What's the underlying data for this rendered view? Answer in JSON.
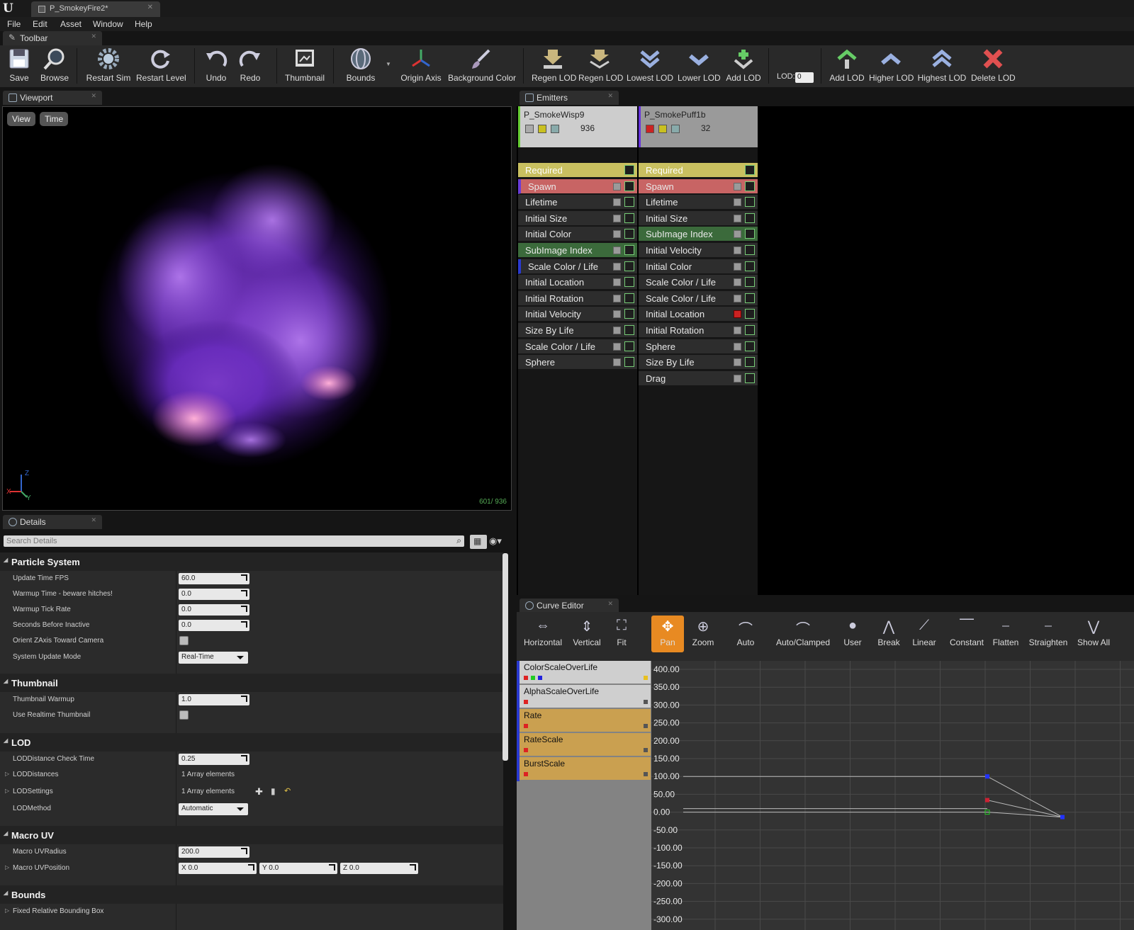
{
  "document": {
    "tab_title": "P_SmokeyFire2*"
  },
  "menu": [
    "File",
    "Edit",
    "Asset",
    "Window",
    "Help"
  ],
  "panels": {
    "toolbar": "Toolbar",
    "viewport": "Viewport",
    "details": "Details",
    "emitters": "Emitters",
    "curve_editor": "Curve Editor"
  },
  "toolbar": {
    "buttons": [
      "Save",
      "Browse",
      "Restart Sim",
      "Restart Level",
      "Undo",
      "Redo",
      "Thumbnail",
      "Bounds",
      "Origin Axis",
      "Background Color",
      "Regen LOD",
      "Regen LOD",
      "Lowest LOD",
      "Lower LOD",
      "Add LOD",
      "Add LOD",
      "Higher LOD",
      "Highest LOD",
      "Delete LOD"
    ],
    "lod_label": "LOD:",
    "lod_value": "0"
  },
  "viewport": {
    "view_button": "View",
    "time_button": "Time",
    "particle_count": "601/ 936",
    "axis_labels": [
      "Z",
      "X",
      "Y"
    ]
  },
  "details": {
    "search_placeholder": "Search Details",
    "categories": {
      "particle_system": {
        "title": "Particle System",
        "update_time_fps": {
          "label": "Update Time FPS",
          "value": "60.0"
        },
        "warmup_time": {
          "label": "Warmup Time - beware hitches!",
          "value": "0.0"
        },
        "warmup_tick_rate": {
          "label": "Warmup Tick Rate",
          "value": "0.0"
        },
        "seconds_before_inactive": {
          "label": "Seconds Before Inactive",
          "value": "0.0"
        },
        "orient_zaxis": {
          "label": "Orient ZAxis Toward Camera"
        },
        "system_update_mode": {
          "label": "System Update Mode",
          "value": "Real-Time"
        }
      },
      "thumbnail": {
        "title": "Thumbnail",
        "thumbnail_warmup": {
          "label": "Thumbnail Warmup",
          "value": "1.0"
        },
        "use_realtime_thumbnail": {
          "label": "Use Realtime Thumbnail"
        }
      },
      "lod": {
        "title": "LOD",
        "lod_distance_check_time": {
          "label": "LODDistance Check Time",
          "value": "0.25"
        },
        "lod_distances": {
          "label": "LODDistances",
          "value": "1 Array elements"
        },
        "lod_settings": {
          "label": "LODSettings",
          "value": "1 Array elements"
        },
        "lod_method": {
          "label": "LODMethod",
          "value": "Automatic"
        }
      },
      "macro_uv": {
        "title": "Macro UV",
        "macro_uv_radius": {
          "label": "Macro UVRadius",
          "value": "200.0"
        },
        "macro_uv_position": {
          "label": "Macro UVPosition",
          "x": "X  0.0",
          "y": "Y  0.0",
          "z": "Z  0.0"
        }
      },
      "bounds": {
        "title": "Bounds",
        "fixed_relative_bbox": {
          "label": "Fixed Relative Bounding Box"
        }
      }
    }
  },
  "emitters": [
    {
      "name": "P_SmokeWisp9",
      "count": "936",
      "modules": [
        {
          "label": "Required",
          "kind": "required"
        },
        {
          "label": "Spawn",
          "kind": "spawn"
        },
        {
          "label": "Lifetime"
        },
        {
          "label": "Initial Size"
        },
        {
          "label": "Initial Color"
        },
        {
          "label": "SubImage Index",
          "kind": "green"
        },
        {
          "label": "Scale Color / Life",
          "kind": "blue"
        },
        {
          "label": "Initial Location"
        },
        {
          "label": "Initial Rotation"
        },
        {
          "label": "Initial Velocity"
        },
        {
          "label": "Size By Life"
        },
        {
          "label": "Scale Color / Life"
        },
        {
          "label": "Sphere"
        }
      ]
    },
    {
      "name": "P_SmokePuff1b",
      "count": "32",
      "modules": [
        {
          "label": "Required",
          "kind": "required"
        },
        {
          "label": "Spawn",
          "kind": "spawn"
        },
        {
          "label": "Lifetime"
        },
        {
          "label": "Initial Size"
        },
        {
          "label": "SubImage Index",
          "kind": "green"
        },
        {
          "label": "Initial Velocity"
        },
        {
          "label": "Initial Color"
        },
        {
          "label": "Scale Color / Life"
        },
        {
          "label": "Scale Color / Life"
        },
        {
          "label": "Initial Location",
          "disabled": true
        },
        {
          "label": "Initial Rotation"
        },
        {
          "label": "Sphere"
        },
        {
          "label": "Size By Life"
        },
        {
          "label": "Drag"
        }
      ]
    }
  ],
  "curve_editor": {
    "buttons": [
      "Horizontal",
      "Vertical",
      "Fit",
      "Pan",
      "Zoom",
      "Auto",
      "Auto/Clamped",
      "User",
      "Break",
      "Linear",
      "Constant",
      "Flatten",
      "Straighten",
      "Show All"
    ],
    "active_button": "Pan",
    "tracks": [
      "ColorScaleOverLife",
      "AlphaScaleOverLife",
      "Rate",
      "RateScale",
      "BurstScale"
    ],
    "y_ticks": [
      "400.00",
      "350.00",
      "300.00",
      "250.00",
      "200.00",
      "150.00",
      "100.00",
      "50.00",
      "0.00",
      "-50.00",
      "-100.00",
      "-150.00",
      "-200.00",
      "-250.00",
      "-300.00"
    ]
  }
}
